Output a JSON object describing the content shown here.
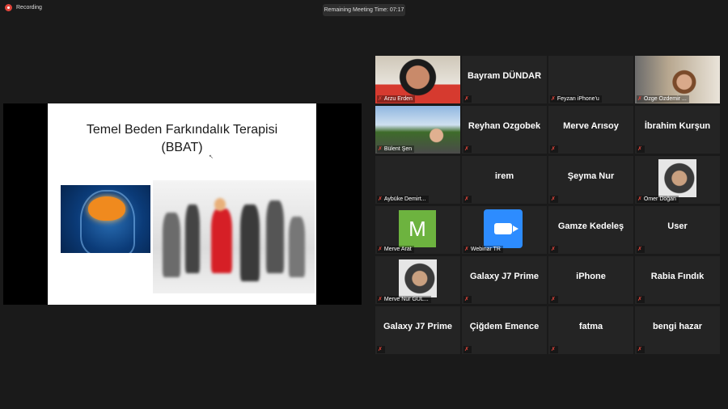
{
  "topbar": {
    "recording_label": "Recording",
    "timer_label": "Remaining Meeting Time: 07:17"
  },
  "slide": {
    "title_line1": "Temel Beden Farkındalık Terapisi",
    "title_line2": "(BBAT)"
  },
  "participants": [
    {
      "name": "Arzu Erden",
      "kind": "video",
      "active": true
    },
    {
      "name": "Bayram DÜNDAR",
      "kind": "name",
      "active": false
    },
    {
      "name": "Feyzan iPhone'u",
      "kind": "blank",
      "active": false
    },
    {
      "name": "Özge Özdemir ...",
      "kind": "video",
      "active": false
    },
    {
      "name": "Bülent Şen",
      "kind": "video",
      "active": false
    },
    {
      "name": "Reyhan Ozgobek",
      "kind": "name",
      "active": false
    },
    {
      "name": "Merve Arısoy",
      "kind": "name",
      "active": false
    },
    {
      "name": "İbrahim Kurşun",
      "kind": "name",
      "active": false
    },
    {
      "name": "Aybüke Demirt...",
      "kind": "blank",
      "active": false
    },
    {
      "name": "irem",
      "kind": "name",
      "active": false
    },
    {
      "name": "Şeyma Nur",
      "kind": "name",
      "active": false
    },
    {
      "name": "Ömer Doğan",
      "kind": "avatar",
      "active": false
    },
    {
      "name": "Merve Arat",
      "kind": "letter",
      "letter": "M",
      "active": false
    },
    {
      "name": "Webinar TR",
      "kind": "zoom",
      "active": false
    },
    {
      "name": "Gamze Kedeleş",
      "kind": "name",
      "active": false
    },
    {
      "name": "User",
      "kind": "name",
      "active": false
    },
    {
      "name": "Merve Nur GÜL...",
      "kind": "avatar",
      "active": false
    },
    {
      "name": "Galaxy J7 Prime",
      "kind": "name",
      "active": false
    },
    {
      "name": "iPhone",
      "kind": "name",
      "active": false
    },
    {
      "name": "Rabia Fındık",
      "kind": "name",
      "active": false
    },
    {
      "name": "Galaxy J7 Prime",
      "kind": "name",
      "active": false
    },
    {
      "name": "Çiğdem Emence",
      "kind": "name",
      "active": false
    },
    {
      "name": "fatma",
      "kind": "name",
      "active": false
    },
    {
      "name": "bengi hazar",
      "kind": "name",
      "active": false
    }
  ],
  "colors": {
    "active_border": "#c6d94a",
    "muted_mic": "#e0443a",
    "zoom_blue": "#2d8cff",
    "letter_avatar": "#6db33f"
  }
}
